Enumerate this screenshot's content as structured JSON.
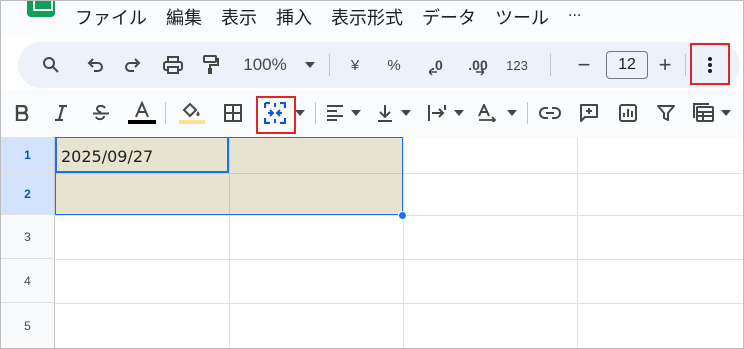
{
  "menu": {
    "items": [
      "ファイル",
      "編集",
      "表示",
      "挿入",
      "表示形式",
      "データ",
      "ツール",
      "..."
    ]
  },
  "toolbar1": {
    "zoom": "100%",
    "currency": "¥",
    "percent": "%",
    "decrease_decimal": ".0",
    "increase_decimal": ".00",
    "number_format": "123",
    "font_size": "12",
    "minus": "−",
    "plus": "+"
  },
  "sheet": {
    "rows": [
      "1",
      "2",
      "3",
      "4",
      "5"
    ],
    "a1_value": "2025/09/27"
  },
  "colors": {
    "highlight_box": "#e0242a",
    "selection_fill": "#e6e4d0",
    "selection_border": "#1a73e8",
    "toolbar_bg": "#edf2fa"
  }
}
